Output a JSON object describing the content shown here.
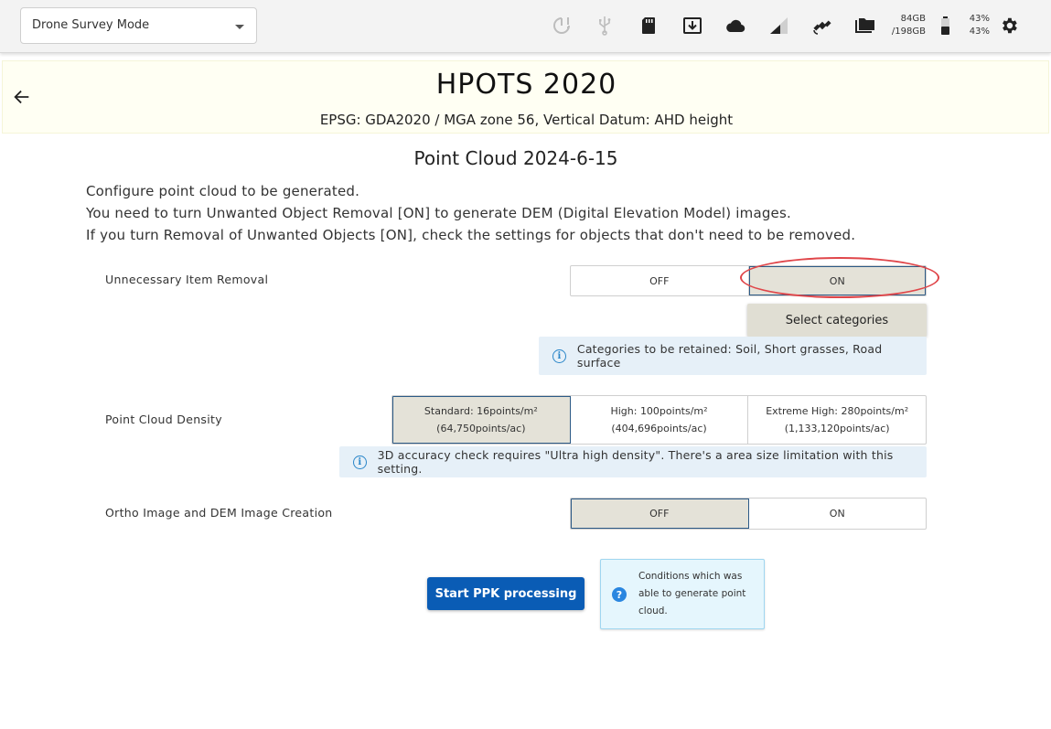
{
  "topbar": {
    "mode_label": "Drone Survey Mode",
    "storage_used": "84GB",
    "storage_total": "/198GB",
    "battery_pct_1": "43%",
    "battery_pct_2": "43%"
  },
  "header": {
    "title": "HPOTS 2020",
    "subtitle": "EPSG: GDA2020 / MGA zone 56, Vertical Datum: AHD height"
  },
  "page": {
    "title": "Point Cloud 2024-6-15",
    "intro": [
      "Configure point cloud to be generated.",
      "You need to turn Unwanted Object Removal [ON] to generate DEM (Digital Elevation Model) images.",
      "If you turn Removal of Unwanted Objects [ON], check the settings for objects that don't need to be removed."
    ]
  },
  "removal": {
    "label": "Unnecessary Item Removal",
    "off": "OFF",
    "on": "ON",
    "selected": "ON",
    "select_categories": "Select categories",
    "retained_info": "Categories to be retained: Soil, Short grasses, Road surface"
  },
  "density": {
    "label": "Point Cloud Density",
    "options": [
      {
        "line1": "Standard: 16points/m²",
        "line2": "(64,750points/ac)"
      },
      {
        "line1": "High: 100points/m²",
        "line2": "(404,696points/ac)"
      },
      {
        "line1": "Extreme High: 280points/m²",
        "line2": "(1,133,120points/ac)"
      }
    ],
    "selected": "Standard: 16points/m²",
    "info": "3D accuracy check requires \"Ultra high density\". There's a area size limitation with this setting."
  },
  "ortho": {
    "label": "Ortho Image and DEM Image Creation",
    "off": "OFF",
    "on": "ON",
    "selected": "OFF"
  },
  "actions": {
    "start_label": "Start PPK processing",
    "conditions_text": "Conditions which was able to generate point cloud."
  },
  "colors": {
    "accent": "#0a5cb5",
    "selected_bg": "#e4e2d8",
    "info_bg": "#e6f0f8",
    "highlight_ring": "#e0464a"
  }
}
